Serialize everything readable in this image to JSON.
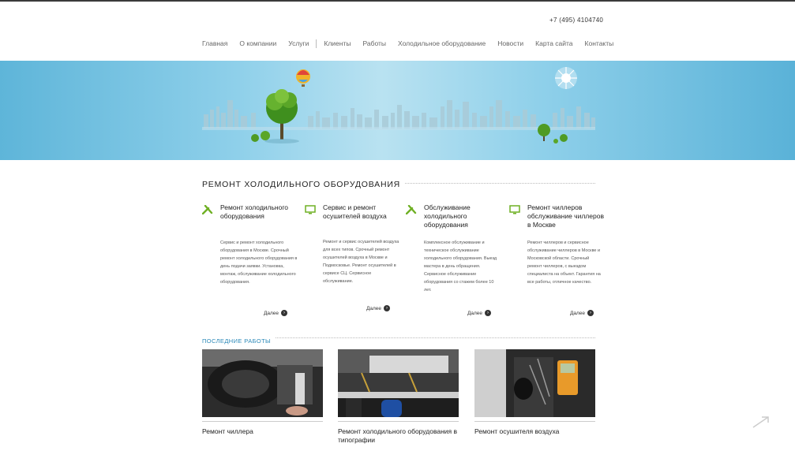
{
  "header": {
    "phone": "+7 (495) 4104740"
  },
  "nav": [
    {
      "label": "Главная"
    },
    {
      "label": "О компании"
    },
    {
      "label": "Услуги"
    },
    {
      "label": "Клиенты"
    },
    {
      "label": "Работы"
    },
    {
      "label": "Холодильное оборудование"
    },
    {
      "label": "Новости"
    },
    {
      "label": "Карта сайта"
    },
    {
      "label": "Контакты"
    }
  ],
  "section": {
    "title": "РЕМОНТ ХОЛОДИЛЬНОГО ОБОРУДОВАНИЯ"
  },
  "services": [
    {
      "title": "Ремонт холодильного оборудования",
      "icon": "wrench-icon",
      "text": "Сервис и ремонт холодильного оборудования в Москве. Срочный ремонт холодильного оборудования в день подачи заявки. Установка, монтаж, обслуживание холодильного оборудования.",
      "more": "Далее"
    },
    {
      "title": "Сервис и ремонт осушителей воздуха",
      "icon": "monitor-icon",
      "text": "Ремонт и сервис осушителей воздуха для всех типов. Срочный ремонт осушителей воздуха в Москве и Подмосковье. Ремонт осушителей в сервисе СЦ. Сервисное обслуживание.",
      "more": "Далее"
    },
    {
      "title": "Обслуживание холодильного оборудования",
      "icon": "wrench-icon",
      "text": "Комплексное обслуживание и техническое обслуживание холодильного оборудования. Выезд мастера в день обращения. Сервисное обслуживание оборудования со стажем более 10 лет.",
      "more": "Далее"
    },
    {
      "title": "Ремонт чиллеров обслуживание чиллеров в Москве",
      "icon": "monitor-icon",
      "text": "Ремонт чиллеров и сервисное обслуживание чиллеров в Москве и Московской области. Срочный ремонт чиллеров, с выездом специалиста на объект. Гарантия на все работы, отличное качество.",
      "more": "Далее"
    }
  ],
  "works": {
    "title": "ПОСЛЕДНИЕ РАБОТЫ",
    "items": [
      {
        "caption": "Ремонт чиллера"
      },
      {
        "caption": "Ремонт холодильного оборудования в типографии"
      },
      {
        "caption": "Ремонт осушителя воздуха"
      }
    ]
  },
  "colors": {
    "accent": "#2b89b8",
    "icon": "#6fb024",
    "sky": "#8fd0ea"
  }
}
